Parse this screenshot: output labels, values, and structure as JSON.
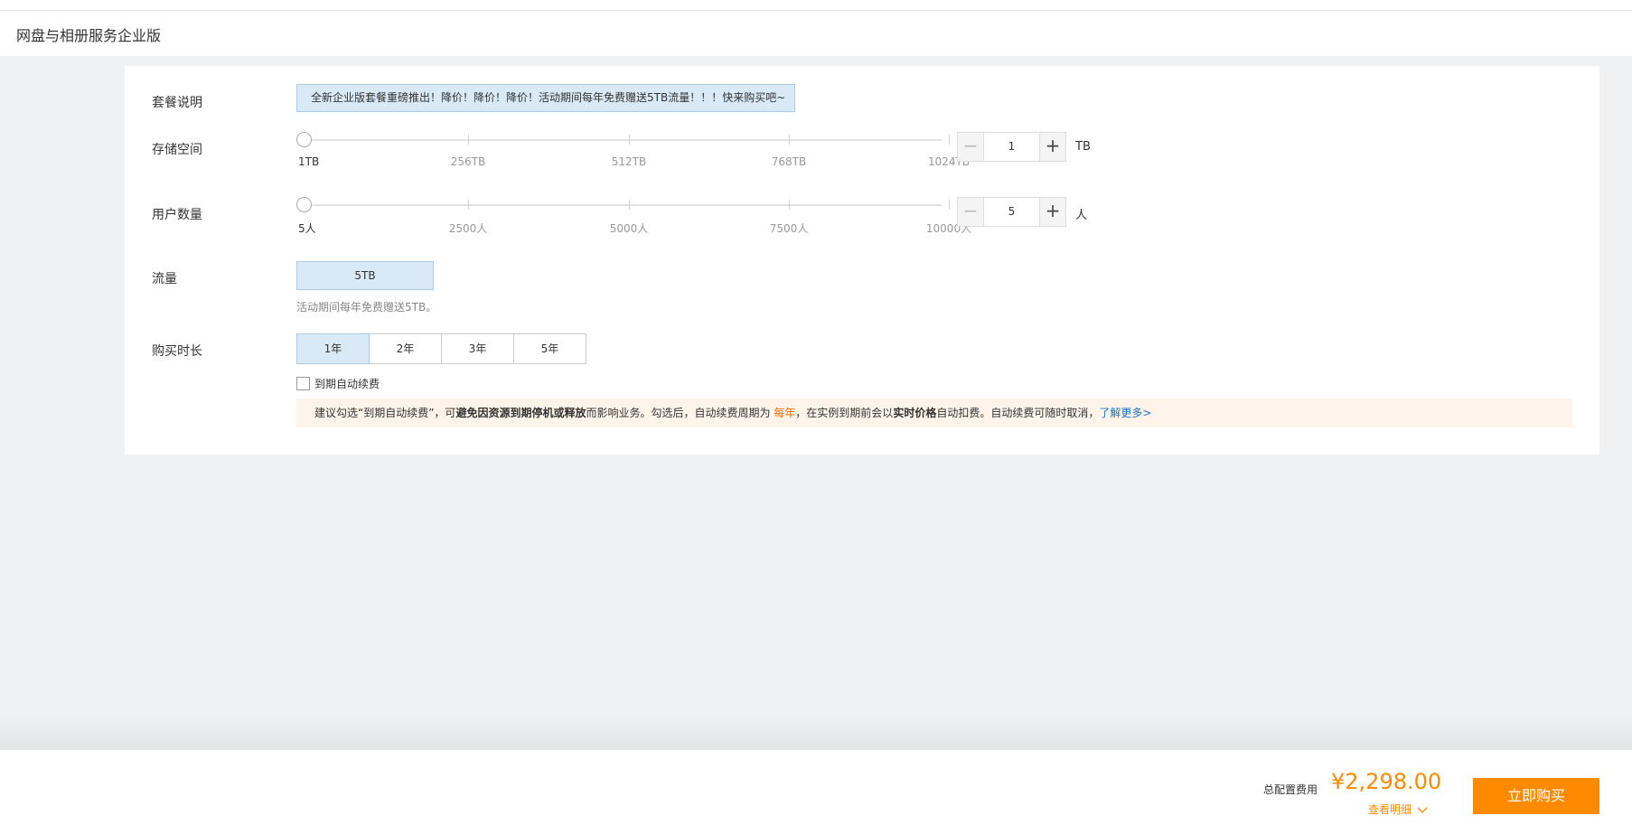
{
  "header": {
    "title": "网盘与相册服务企业版"
  },
  "form": {
    "package": {
      "label": "套餐说明",
      "notice": "全新企业版套餐重磅推出！降价！降价！降价！活动期间每年免费赠送5TB流量！！！快来购买吧~"
    },
    "storage": {
      "label": "存储空间",
      "ticks": [
        "1TB",
        "256TB",
        "512TB",
        "768TB",
        "1024TB"
      ],
      "slider_value": 1,
      "value": "1",
      "unit": "TB",
      "minus": "−",
      "plus": "+"
    },
    "users": {
      "label": "用户数量",
      "ticks": [
        "5人",
        "2500人",
        "5000人",
        "7500人",
        "10000人"
      ],
      "slider_value": 5,
      "value": "5",
      "unit": "人",
      "minus": "−",
      "plus": "+"
    },
    "traffic": {
      "label": "流量",
      "value": "5TB",
      "note": "活动期间每年免费赠送5TB。"
    },
    "duration": {
      "label": "购买时长",
      "options": [
        "1年",
        "2年",
        "3年",
        "5年"
      ],
      "selected": "1年"
    },
    "auto_renew": {
      "label": "到期自动续费",
      "checked": false
    },
    "tip": {
      "p1": "建议勾选“到期自动续费”，可",
      "b1": "避免因资源到期停机或释放",
      "p2": "而影响业务。勾选后，自动续费周期为 ",
      "o1": "每年",
      "p3": "，在实例到期前会以",
      "b2": "实时价格",
      "p4": "自动扣费。自动续费可随时取消，",
      "link": "了解更多>"
    }
  },
  "footer": {
    "total_label": "总配置费用",
    "price": "¥2,298.00",
    "detail": "查看明细",
    "buy": "立即购买"
  },
  "colors": {
    "accent": "#ff8a00",
    "selected_bg": "#d9e9f6",
    "link": "#1a74c3"
  }
}
